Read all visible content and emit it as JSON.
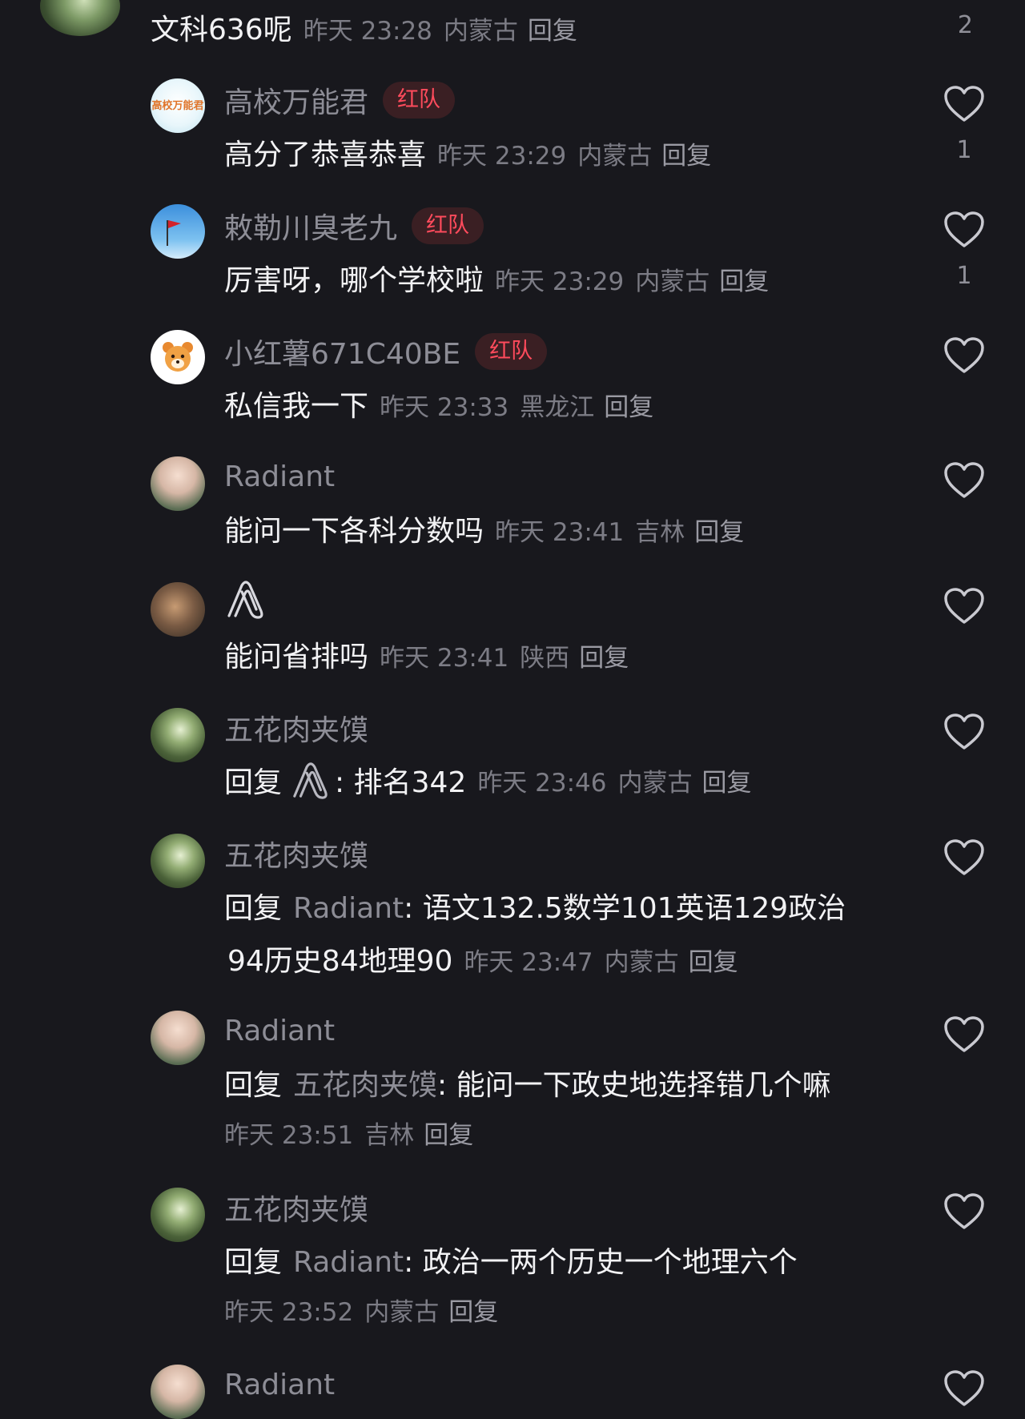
{
  "top_comment": {
    "text": "文科636呢",
    "time": "昨天 23:28",
    "location": "内蒙古",
    "reply_label": "回复",
    "like_count": "2"
  },
  "replies": [
    {
      "name": "高校万能君",
      "badge": "红队",
      "avatar_text": "高校万能君",
      "text": "高分了恭喜恭喜",
      "time": "昨天 23:29",
      "location": "内蒙古",
      "reply_label": "回复",
      "likes": "1"
    },
    {
      "name": "敕勒川臭老九",
      "badge": "红队",
      "text": "厉害呀，哪个学校啦",
      "time": "昨天 23:29",
      "location": "内蒙古",
      "reply_label": "回复",
      "likes": "1"
    },
    {
      "name": "小红薯671C40BE",
      "badge": "红队",
      "text": "私信我一下",
      "time": "昨天 23:33",
      "location": "黑龙江",
      "reply_label": "回复"
    },
    {
      "name": "Radiant",
      "text": "能问一下各科分数吗",
      "time": "昨天 23:41",
      "location": "吉林",
      "reply_label": "回复"
    },
    {
      "name_icon": "paperclip-icon",
      "text": "能问省排吗",
      "time": "昨天 23:41",
      "location": "陕西",
      "reply_label": "回复"
    },
    {
      "name": "五花肉夹馍",
      "prefix": "回复",
      "mention_icon": "paperclip-icon",
      "text": ": 排名342",
      "time": "昨天 23:46",
      "location": "内蒙古",
      "reply_label": "回复"
    },
    {
      "name": "五花肉夹馍",
      "prefix": "回复",
      "mention": "Radiant",
      "text_line1": ": 语文132.5数学101英语129政治",
      "text_line2": "94历史84地理90",
      "time": "昨天 23:47",
      "location": "内蒙古",
      "reply_label": "回复"
    },
    {
      "name": "Radiant",
      "prefix": "回复",
      "mention": "五花肉夹馍",
      "text": ": 能问一下政史地选择错几个嘛",
      "time": "昨天 23:51",
      "location": "吉林",
      "reply_label": "回复"
    },
    {
      "name": "五花肉夹馍",
      "prefix": "回复",
      "mention": "Radiant",
      "text": ": 政治一两个历史一个地理六个",
      "time": "昨天 23:52",
      "location": "内蒙古",
      "reply_label": "回复"
    },
    {
      "name": "Radiant"
    }
  ],
  "icons": {
    "like": "heart-icon",
    "paperclip": "paperclip-icon"
  },
  "colors": {
    "background": "#18181d",
    "badge_text": "#ff4b5c",
    "badge_bg": "#3a1f23"
  }
}
